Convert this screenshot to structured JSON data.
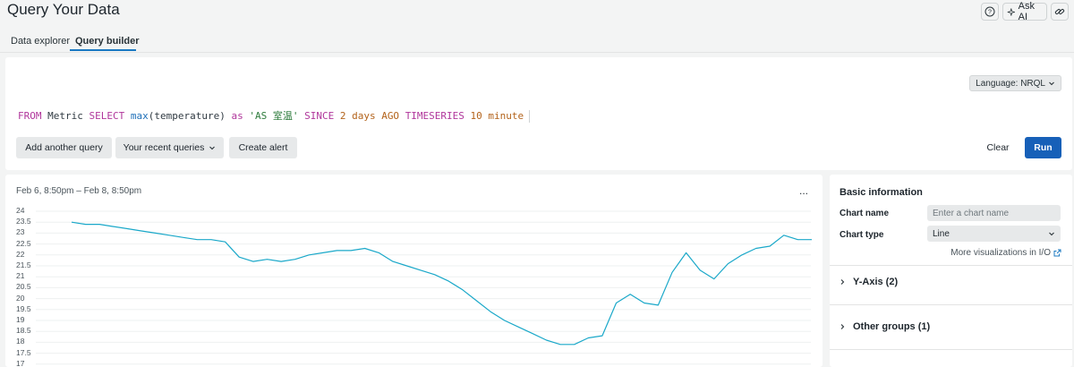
{
  "header": {
    "title": "Query Your Data",
    "ask_ai_label": "Ask AI",
    "help_icon": "help-circle-icon",
    "sparkle_icon": "sparkle-icon",
    "link_icon": "link-icon"
  },
  "tabs": [
    {
      "label": "Data explorer",
      "active": false
    },
    {
      "label": "Query builder",
      "active": true
    }
  ],
  "query_editor": {
    "language_label": "Language: NRQL",
    "tokens": [
      {
        "text": "FROM",
        "type": "kw"
      },
      {
        "text": " Metric ",
        "type": "plain"
      },
      {
        "text": "SELECT",
        "type": "kw"
      },
      {
        "text": " ",
        "type": "plain"
      },
      {
        "text": "max",
        "type": "fn"
      },
      {
        "text": "(temperature) ",
        "type": "plain"
      },
      {
        "text": "as",
        "type": "kw"
      },
      {
        "text": " ",
        "type": "plain"
      },
      {
        "text": "'AS 室温'",
        "type": "str"
      },
      {
        "text": " ",
        "type": "plain"
      },
      {
        "text": "SINCE",
        "type": "kw"
      },
      {
        "text": " ",
        "type": "plain"
      },
      {
        "text": "2",
        "type": "num"
      },
      {
        "text": " ",
        "type": "plain"
      },
      {
        "text": "days AGO",
        "type": "num"
      },
      {
        "text": " ",
        "type": "plain"
      },
      {
        "text": "TIMESERIES",
        "type": "kw"
      },
      {
        "text": " ",
        "type": "plain"
      },
      {
        "text": "10 minute",
        "type": "num"
      }
    ],
    "add_query_label": "Add another query",
    "recent_label": "Your recent queries",
    "create_alert_label": "Create alert",
    "clear_label": "Clear",
    "run_label": "Run"
  },
  "chart": {
    "time_range": "Feb 6, 8:50pm – Feb 8, 8:50pm",
    "more_label": "...",
    "line_color": "#1aa8c9"
  },
  "chart_data": {
    "type": "line",
    "y_ticks": [
      "24",
      "23.5",
      "23",
      "22.5",
      "22",
      "21.5",
      "21",
      "20.5",
      "20",
      "19.5",
      "19",
      "18.5",
      "18",
      "17.5",
      "17"
    ],
    "ylim": [
      17,
      24
    ],
    "x": [
      0.0,
      0.02,
      0.04,
      0.05,
      0.07,
      0.1,
      0.14,
      0.17,
      0.19,
      0.23,
      0.26,
      0.28,
      0.29,
      0.3,
      0.31,
      0.33,
      0.35,
      0.37,
      0.39,
      0.41,
      0.44,
      0.47,
      0.48,
      0.49,
      0.5,
      0.52,
      0.54,
      0.57,
      0.6,
      0.63,
      0.66,
      0.69,
      0.72,
      0.75,
      0.78,
      0.81,
      0.84,
      0.85,
      0.86,
      0.87,
      0.88,
      0.89,
      0.9,
      0.91,
      0.92,
      0.93,
      0.94,
      0.95,
      0.96,
      0.97,
      0.98,
      0.99,
      1.0,
      1.01,
      1.02,
      1.03,
      1.04,
      1.05,
      1.06,
      1.07,
      1.08,
      1.09
    ],
    "series": [
      {
        "values": [
          23.5,
          23.4,
          23.4,
          23.3,
          23.2,
          23.1,
          23.0,
          22.9,
          22.8,
          22.7,
          22.7,
          22.6,
          21.9,
          21.7,
          21.8,
          21.7,
          21.8,
          22.0,
          22.1,
          22.2,
          22.2,
          22.3,
          22.1,
          21.7,
          21.5,
          21.3,
          21.1,
          20.8,
          20.4,
          19.9,
          19.4,
          19.0,
          18.7,
          18.4,
          18.1,
          17.9,
          17.9,
          18.2,
          18.3,
          19.8,
          20.2,
          19.8,
          19.7,
          21.2,
          22.1,
          21.3,
          20.9,
          21.6,
          22.0,
          22.3,
          22.4,
          22.9,
          22.7,
          22.7
        ]
      }
    ]
  },
  "settings": {
    "basic_info_title": "Basic information",
    "chart_name_label": "Chart name",
    "chart_name_placeholder": "Enter a chart name",
    "chart_type_label": "Chart type",
    "chart_type_value": "Line",
    "more_viz_label": "More visualizations in I/O",
    "y_axis_label": "Y-Axis (2)",
    "other_groups_label": "Other groups (1)"
  }
}
